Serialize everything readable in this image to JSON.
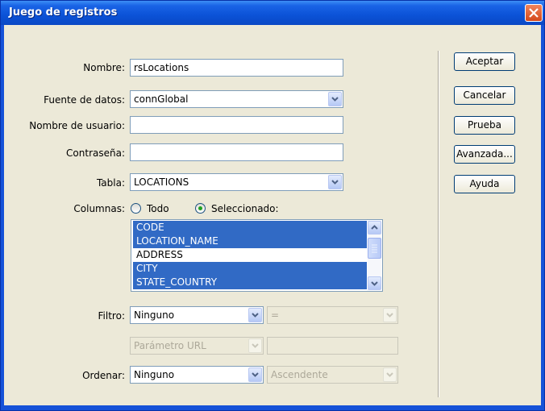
{
  "window": {
    "title": "Juego de registros",
    "close_icon": "close-icon"
  },
  "form": {
    "nombre_label": "Nombre:",
    "nombre_value": "rsLocations",
    "fuente_label": "Fuente de datos:",
    "fuente_value": "connGlobal",
    "usuario_label": "Nombre de usuario:",
    "usuario_value": "",
    "contrasena_label": "Contraseña:",
    "contrasena_value": "",
    "tabla_label": "Tabla:",
    "tabla_value": "LOCATIONS",
    "columnas_label": "Columnas:",
    "radio_todo": "Todo",
    "radio_seleccionado": "Seleccionado:",
    "columns": [
      {
        "name": "CODE",
        "selected": true
      },
      {
        "name": "LOCATION_NAME",
        "selected": true
      },
      {
        "name": "ADDRESS",
        "selected": false
      },
      {
        "name": "CITY",
        "selected": true
      },
      {
        "name": "STATE_COUNTRY",
        "selected": true
      }
    ],
    "filtro_label": "Filtro:",
    "filtro_value": "Ninguno",
    "filtro_operator": "=",
    "filtro_param": "Parámetro URL",
    "filtro_param_value": "",
    "ordenar_label": "Ordenar:",
    "ordenar_value": "Ninguno",
    "ordenar_direction": "Ascendente"
  },
  "buttons": {
    "aceptar": "Aceptar",
    "cancelar": "Cancelar",
    "prueba": "Prueba",
    "avanzada": "Avanzada...",
    "ayuda": "Ayuda"
  },
  "colors": {
    "titlebar": "#0b52d7",
    "selection": "#316ac5",
    "dialog_bg": "#ece9d8"
  }
}
